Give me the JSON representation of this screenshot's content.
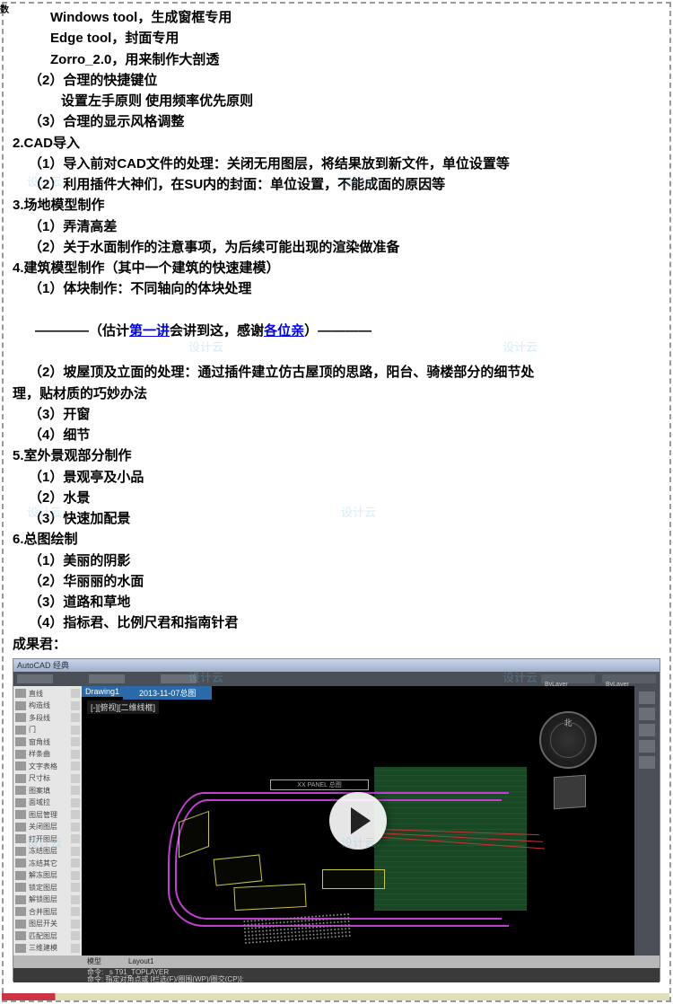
{
  "corner": "数",
  "lines": [
    {
      "cls": "indent1",
      "text": "Windows tool，生成窗框专用"
    },
    {
      "cls": "indent1",
      "text": "Edge tool，封面专用"
    },
    {
      "cls": "indent1",
      "text": "Zorro_2.0，用来制作大剖透"
    },
    {
      "cls": "indent0",
      "text": "（2）合理的快捷键位"
    },
    {
      "cls": "indent2",
      "text": "设置左手原则 使用频率优先原则"
    },
    {
      "cls": "indent0",
      "text": "（3）合理的显示风格调整"
    },
    {
      "cls": "noindent",
      "text": "2.CAD导入"
    },
    {
      "cls": "indent0",
      "text": "（1）导入前对CAD文件的处理：关闭无用图层，将结果放到新文件，单位设置等"
    },
    {
      "cls": "indent0",
      "text": "（2）利用插件大神们，在SU内的封面：单位设置，不能成面的原因等"
    },
    {
      "cls": "noindent",
      "text": "3.场地模型制作"
    },
    {
      "cls": "indent0",
      "text": "（1）弄清高差"
    },
    {
      "cls": "indent0",
      "text": "（2）关于水面制作的注意事项，为后续可能出现的渲染做准备"
    },
    {
      "cls": "noindent",
      "text": "4.建筑模型制作（其中一个建筑的快速建模）"
    },
    {
      "cls": "indent0",
      "text": "（1）体块制作：不同轴向的体块处理"
    }
  ],
  "divider_a": "————（估计",
  "divider_link1": "第一讲",
  "divider_b": "会讲到这，感谢",
  "divider_link2": "各位亲",
  "divider_c": "）————",
  "lines2": [
    {
      "cls": "indent0",
      "text": "（2）坡屋顶及立面的处理：通过插件建立仿古屋顶的思路，阳台、骑楼部分的细节处"
    },
    {
      "cls": "noindent",
      "text": "理，贴材质的巧妙办法"
    },
    {
      "cls": "indent0",
      "text": "（3）开窗"
    },
    {
      "cls": "indent0",
      "text": "（4）细节"
    },
    {
      "cls": "noindent",
      "text": "5.室外景观部分制作"
    },
    {
      "cls": "indent0",
      "text": "（1）景观亭及小品"
    },
    {
      "cls": "indent0",
      "text": "（2）水景"
    },
    {
      "cls": "indent0",
      "text": "（3）快速加配景"
    },
    {
      "cls": "noindent",
      "text": "6.总图绘制"
    },
    {
      "cls": "indent0",
      "text": "（1）美丽的阴影"
    },
    {
      "cls": "indent0",
      "text": "（2）华丽丽的水面"
    },
    {
      "cls": "indent0",
      "text": "（3）道路和草地"
    },
    {
      "cls": "indent0",
      "text": "（4）指标君、比例尺君和指南针君"
    },
    {
      "cls": "noindent",
      "text": "成果君："
    }
  ],
  "watermark_text": "设计云",
  "video": {
    "title": "AutoCAD 经典",
    "tab1": "Drawing1",
    "tab2": "2013-11-07总图",
    "canvas_label": "[-][俯视][二维线框]",
    "compass_n": "北",
    "drawing_title": "XX PANEL 总图",
    "left_items": [
      "直线",
      "构造线",
      "多段线",
      "门",
      "窗角线",
      "样条曲",
      "文字表格",
      "尺寸标",
      "图案填",
      "面域拉",
      "图层管理",
      "关闭图层",
      "打开图层",
      "冻结图层",
      "冻结其它",
      "解冻图层",
      "锁定图层",
      "解锁图层",
      "合并图层",
      "图层开关",
      "匹配图层",
      "三维建模"
    ],
    "status_left": "模型",
    "status_layout": "Layout1",
    "cmd_prefix": "命令: _s T91_TOPLAYER",
    "cmd1": "命令: 指定对角点或 [栏选(F)/圈围(WP)/圈交(CP)]:",
    "cmd2": "命令: 指定对角点或 [栏选(F)/圈围(WP)/圈交(CP)]:",
    "bylayer": "ByLayer"
  }
}
